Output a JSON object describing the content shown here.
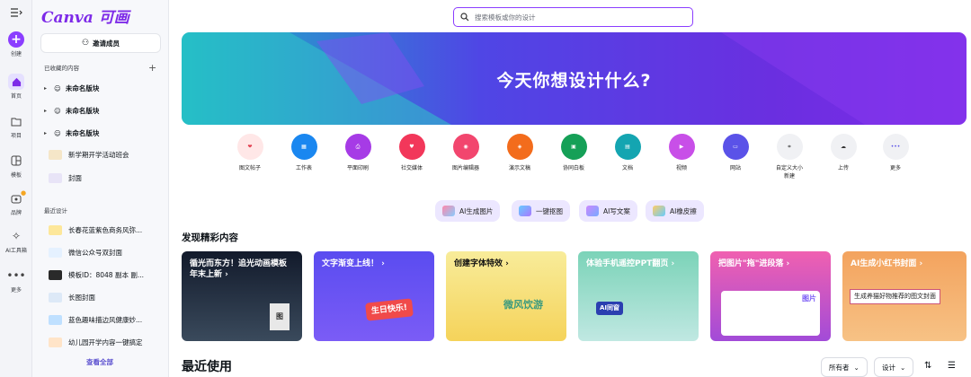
{
  "rail": {
    "create": "创建",
    "home": "首页",
    "projects": "项目",
    "templates": "模板",
    "brand": "品牌",
    "ai_tools": "AI工具箱",
    "more": "更多"
  },
  "sidebar": {
    "logo": "Canva 可画",
    "invite": "邀请成员",
    "favorites_title": "已收藏的内容",
    "favorites": [
      "未命名版块",
      "未命名版块",
      "未命名版块"
    ],
    "recent_title": "最近设计",
    "recent": [
      {
        "label": "新学期开学活动班会",
        "color": "#f5e6c8"
      },
      {
        "label": "封面",
        "color": "#e8e4f7"
      },
      {
        "label": "长春花蓝紫色商务风弥...",
        "color": "#fde79a"
      },
      {
        "label": "微信公众号双封面",
        "color": "#e5f1ff"
      },
      {
        "label": "模板ID：8048 副本 副...",
        "color": "#2a2a2a"
      },
      {
        "label": "长图封面",
        "color": "#dde9f7"
      },
      {
        "label": "蓝色趣味描边风健康妙...",
        "color": "#bfe0ff"
      },
      {
        "label": "幼儿园开学内容一键搞定",
        "color": "#ffe4c8"
      }
    ],
    "view_all": "查看全部"
  },
  "search": {
    "placeholder": "搜索模板或你的设计"
  },
  "hero": {
    "title": "今天你想设计什么?"
  },
  "categories": [
    {
      "label": "图文帖子",
      "bg": "#ffe7e7",
      "fg": "#e23e4e"
    },
    {
      "label": "工作表",
      "bg": "#1a87f0",
      "fg": "#ffffff"
    },
    {
      "label": "平面印刷",
      "bg": "#a63be6",
      "fg": "#ffffff"
    },
    {
      "label": "社交媒体",
      "bg": "#f2375a",
      "fg": "#ffffff"
    },
    {
      "label": "图片编辑器",
      "bg": "#f2466e",
      "fg": "#ffffff"
    },
    {
      "label": "演示文稿",
      "bg": "#f36c1c",
      "fg": "#ffffff"
    },
    {
      "label": "协同白板",
      "bg": "#15a057",
      "fg": "#ffffff"
    },
    {
      "label": "文档",
      "bg": "#14a5b1",
      "fg": "#ffffff"
    },
    {
      "label": "视频",
      "bg": "#c84fe8",
      "fg": "#ffffff"
    },
    {
      "label": "网站",
      "bg": "#5a52e8",
      "fg": "#ffffff"
    },
    {
      "label": "自定义大小",
      "label2": "新建",
      "bg": "#f0f1f4",
      "fg": "#333333"
    },
    {
      "label": "上传",
      "bg": "#f0f1f4",
      "fg": "#333333"
    },
    {
      "label": "更多",
      "bg": "#f0f1f4",
      "fg": "#5a52e8"
    }
  ],
  "ai_pills": [
    "AI生成图片",
    "一键抠图",
    "AI写文案",
    "AI橡皮擦"
  ],
  "discover": {
    "title": "发现精彩内容",
    "cards": [
      {
        "title": "循光而东方！追光动画模板年末上新 ›",
        "bg": "linear-gradient(180deg,#121a2b,#3a4a5c)",
        "art": "图"
      },
      {
        "title": "文字渐变上线！ ›",
        "bg": "linear-gradient(180deg,#5a4cf0,#7b5cf6)",
        "art": "生日快乐!"
      },
      {
        "title": "创建字体特效 ›",
        "bg": "linear-gradient(180deg,#f8ec9a,#f5d35a)",
        "art": "微风饮游"
      },
      {
        "title": "体验手机遥控PPT翻页 ›",
        "bg": "linear-gradient(180deg,#7bd3b8,#c0e8e2)",
        "art": "AI同窗"
      },
      {
        "title": "把图片\"拖\"进段落 ›",
        "bg": "linear-gradient(180deg,#f060b0,#a24bd8)",
        "art": "图片"
      },
      {
        "title": "AI生成小红书封面 ›",
        "bg": "linear-gradient(180deg,#f3a35e,#f7c285)",
        "art": "生成养猫好物推荐的图文封面"
      }
    ]
  },
  "recent_used": {
    "title": "最近使用",
    "owner": "所有者",
    "design": "设计"
  }
}
